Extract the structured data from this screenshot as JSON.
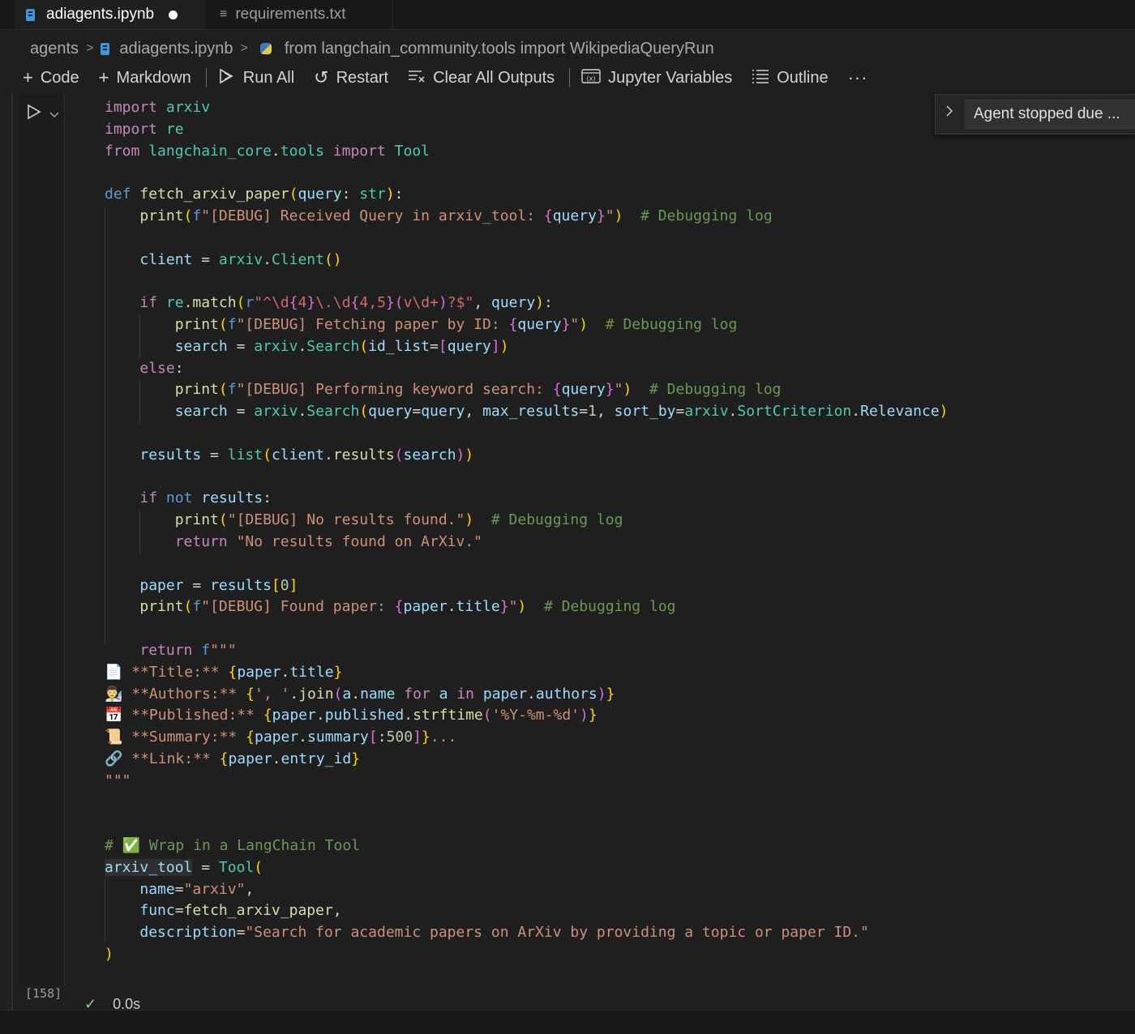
{
  "tabs": [
    {
      "label": "adiagents.ipynb",
      "dirty": true
    },
    {
      "label": "requirements.txt"
    }
  ],
  "breadcrumb": {
    "items": [
      "agents",
      "adiagents.ipynb",
      "from langchain_community.tools import WikipediaQueryRun"
    ]
  },
  "toolbar": {
    "code": "Code",
    "markdown": "Markdown",
    "run_all": "Run All",
    "restart": "Restart",
    "clear_all_outputs": "Clear All Outputs",
    "jupyter_variables": "Jupyter Variables",
    "outline": "Outline",
    "more": "···"
  },
  "cell": {
    "execution_count": "[158]",
    "status_time": "0.0s",
    "code_lines": [
      "import arxiv",
      "import re",
      "from langchain_core.tools import Tool",
      "",
      "def fetch_arxiv_paper(query: str):",
      "    print(f\"[DEBUG] Received Query in arxiv_tool: {query}\")  # Debugging log",
      "",
      "    client = arxiv.Client()",
      "",
      "    if re.match(r\"^\\d{4}\\.\\d{4,5}(v\\d+)?$\", query):",
      "        print(f\"[DEBUG] Fetching paper by ID: {query}\")  # Debugging log",
      "        search = arxiv.Search(id_list=[query])",
      "    else:",
      "        print(f\"[DEBUG] Performing keyword search: {query}\")  # Debugging log",
      "        search = arxiv.Search(query=query, max_results=1, sort_by=arxiv.SortCriterion.Relevance)",
      "",
      "    results = list(client.results(search))",
      "",
      "    if not results:",
      "        print(\"[DEBUG] No results found.\")  # Debugging log",
      "        return \"No results found on ArXiv.\"",
      "",
      "    paper = results[0]",
      "    print(f\"[DEBUG] Found paper: {paper.title}\")  # Debugging log",
      "",
      "    return f\"\"\"",
      "📄 **Title:** {paper.title}",
      "👨‍🔬 **Authors:** {', '.join(a.name for a in paper.authors)}",
      "📅 **Published:** {paper.published.strftime('%Y-%m-%d')}",
      "📜 **Summary:** {paper.summary[:500]}...",
      "🔗 **Link:** {paper.entry_id}",
      "\"\"\"",
      "",
      "",
      "# ✅ Wrap in a LangChain Tool",
      "arxiv_tool = Tool(",
      "    name=\"arxiv\",",
      "    func=fetch_arxiv_paper,",
      "    description=\"Search for academic papers on ArXiv by providing a topic or paper ID.\"",
      ")"
    ]
  },
  "agent_widget": {
    "text": "Agent stopped due ..."
  },
  "colors": {
    "editor_bg": "#1f1f1f",
    "keyword": "#c586c0",
    "storage": "#569cd6",
    "function": "#dcdcaa",
    "variable": "#9cdcfe",
    "string": "#ce9178",
    "comment": "#6a9955",
    "class": "#4ec9b0",
    "success": "#89d185"
  }
}
